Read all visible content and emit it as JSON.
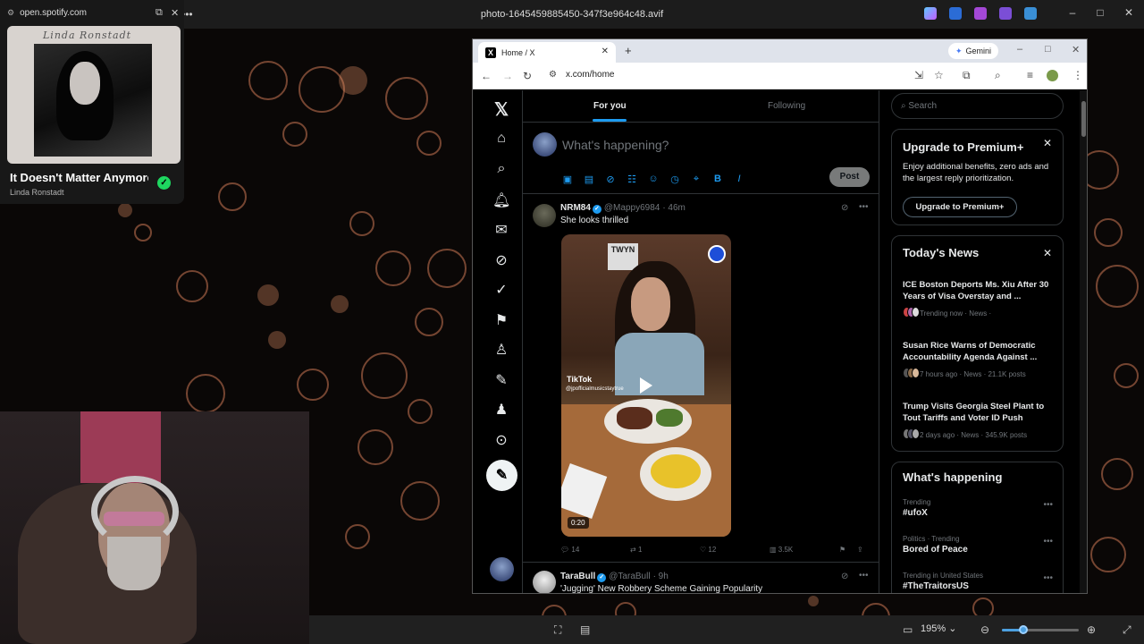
{
  "viewer": {
    "title": "photo-1645459885450-347f3e964c48.avif",
    "zoom": "195%",
    "zoom_fraction": 0.28
  },
  "spotify": {
    "url": "open.spotify.com",
    "song": "It Doesn't Matter Anymore",
    "artist": "Linda Ronstadt",
    "album_script": "Linda Ronstadt"
  },
  "browser": {
    "tab_title": "Home / X",
    "url": "x.com/home",
    "gemini_label": "Gemini"
  },
  "timeline": {
    "tabs": [
      {
        "label": "For you",
        "active": true
      },
      {
        "label": "Following",
        "active": false
      }
    ],
    "composer_placeholder": "What's happening?",
    "post_label": "Post"
  },
  "tweets": [
    {
      "name": "NRM84",
      "handle": "@Mappy6984",
      "time": "· 46m",
      "text": "She looks thrilled",
      "media": {
        "sign_text": "TWYN",
        "watermark": "TikTok",
        "watermark_handle": "@jpofficialmusicstaytrue",
        "duration": "0:20"
      },
      "replies": "14",
      "reposts": "1",
      "likes": "12",
      "views": "3.5K"
    },
    {
      "name": "TaraBull",
      "handle": "@TaraBull",
      "time": "· 9h",
      "text": "'Jugging' New Robbery Scheme Gaining Popularity"
    }
  ],
  "sidebar": {
    "search_placeholder": "Search",
    "premium": {
      "title": "Upgrade to Premium+",
      "text": "Enjoy additional benefits, zero ads and the largest reply prioritization.",
      "button": "Upgrade to Premium+"
    },
    "news": {
      "title": "Today's News",
      "items": [
        {
          "headline": "ICE Boston Deports Ms. Xiu After 30 Years of Visa Overstay and ...",
          "meta": "Trending now · News ·"
        },
        {
          "headline": "Susan Rice Warns of Democratic Accountability Agenda Against ...",
          "meta": "7 hours ago · News · 21.1K posts"
        },
        {
          "headline": "Trump Visits Georgia Steel Plant to Tout Tariffs and Voter ID Push",
          "meta": "2 days ago · News · 345.9K posts"
        }
      ]
    },
    "happening": {
      "title": "What's happening",
      "trends": [
        {
          "context": "Trending",
          "name": "#ufoX"
        },
        {
          "context": "Politics · Trending",
          "name": "Bored of Peace"
        },
        {
          "context": "Trending in United States",
          "name": "#TheTraitorsUS"
        }
      ]
    }
  },
  "colors": {
    "accent": "#1d9bf0",
    "spotify_green": "#1ed760",
    "x_background": "#000000"
  }
}
